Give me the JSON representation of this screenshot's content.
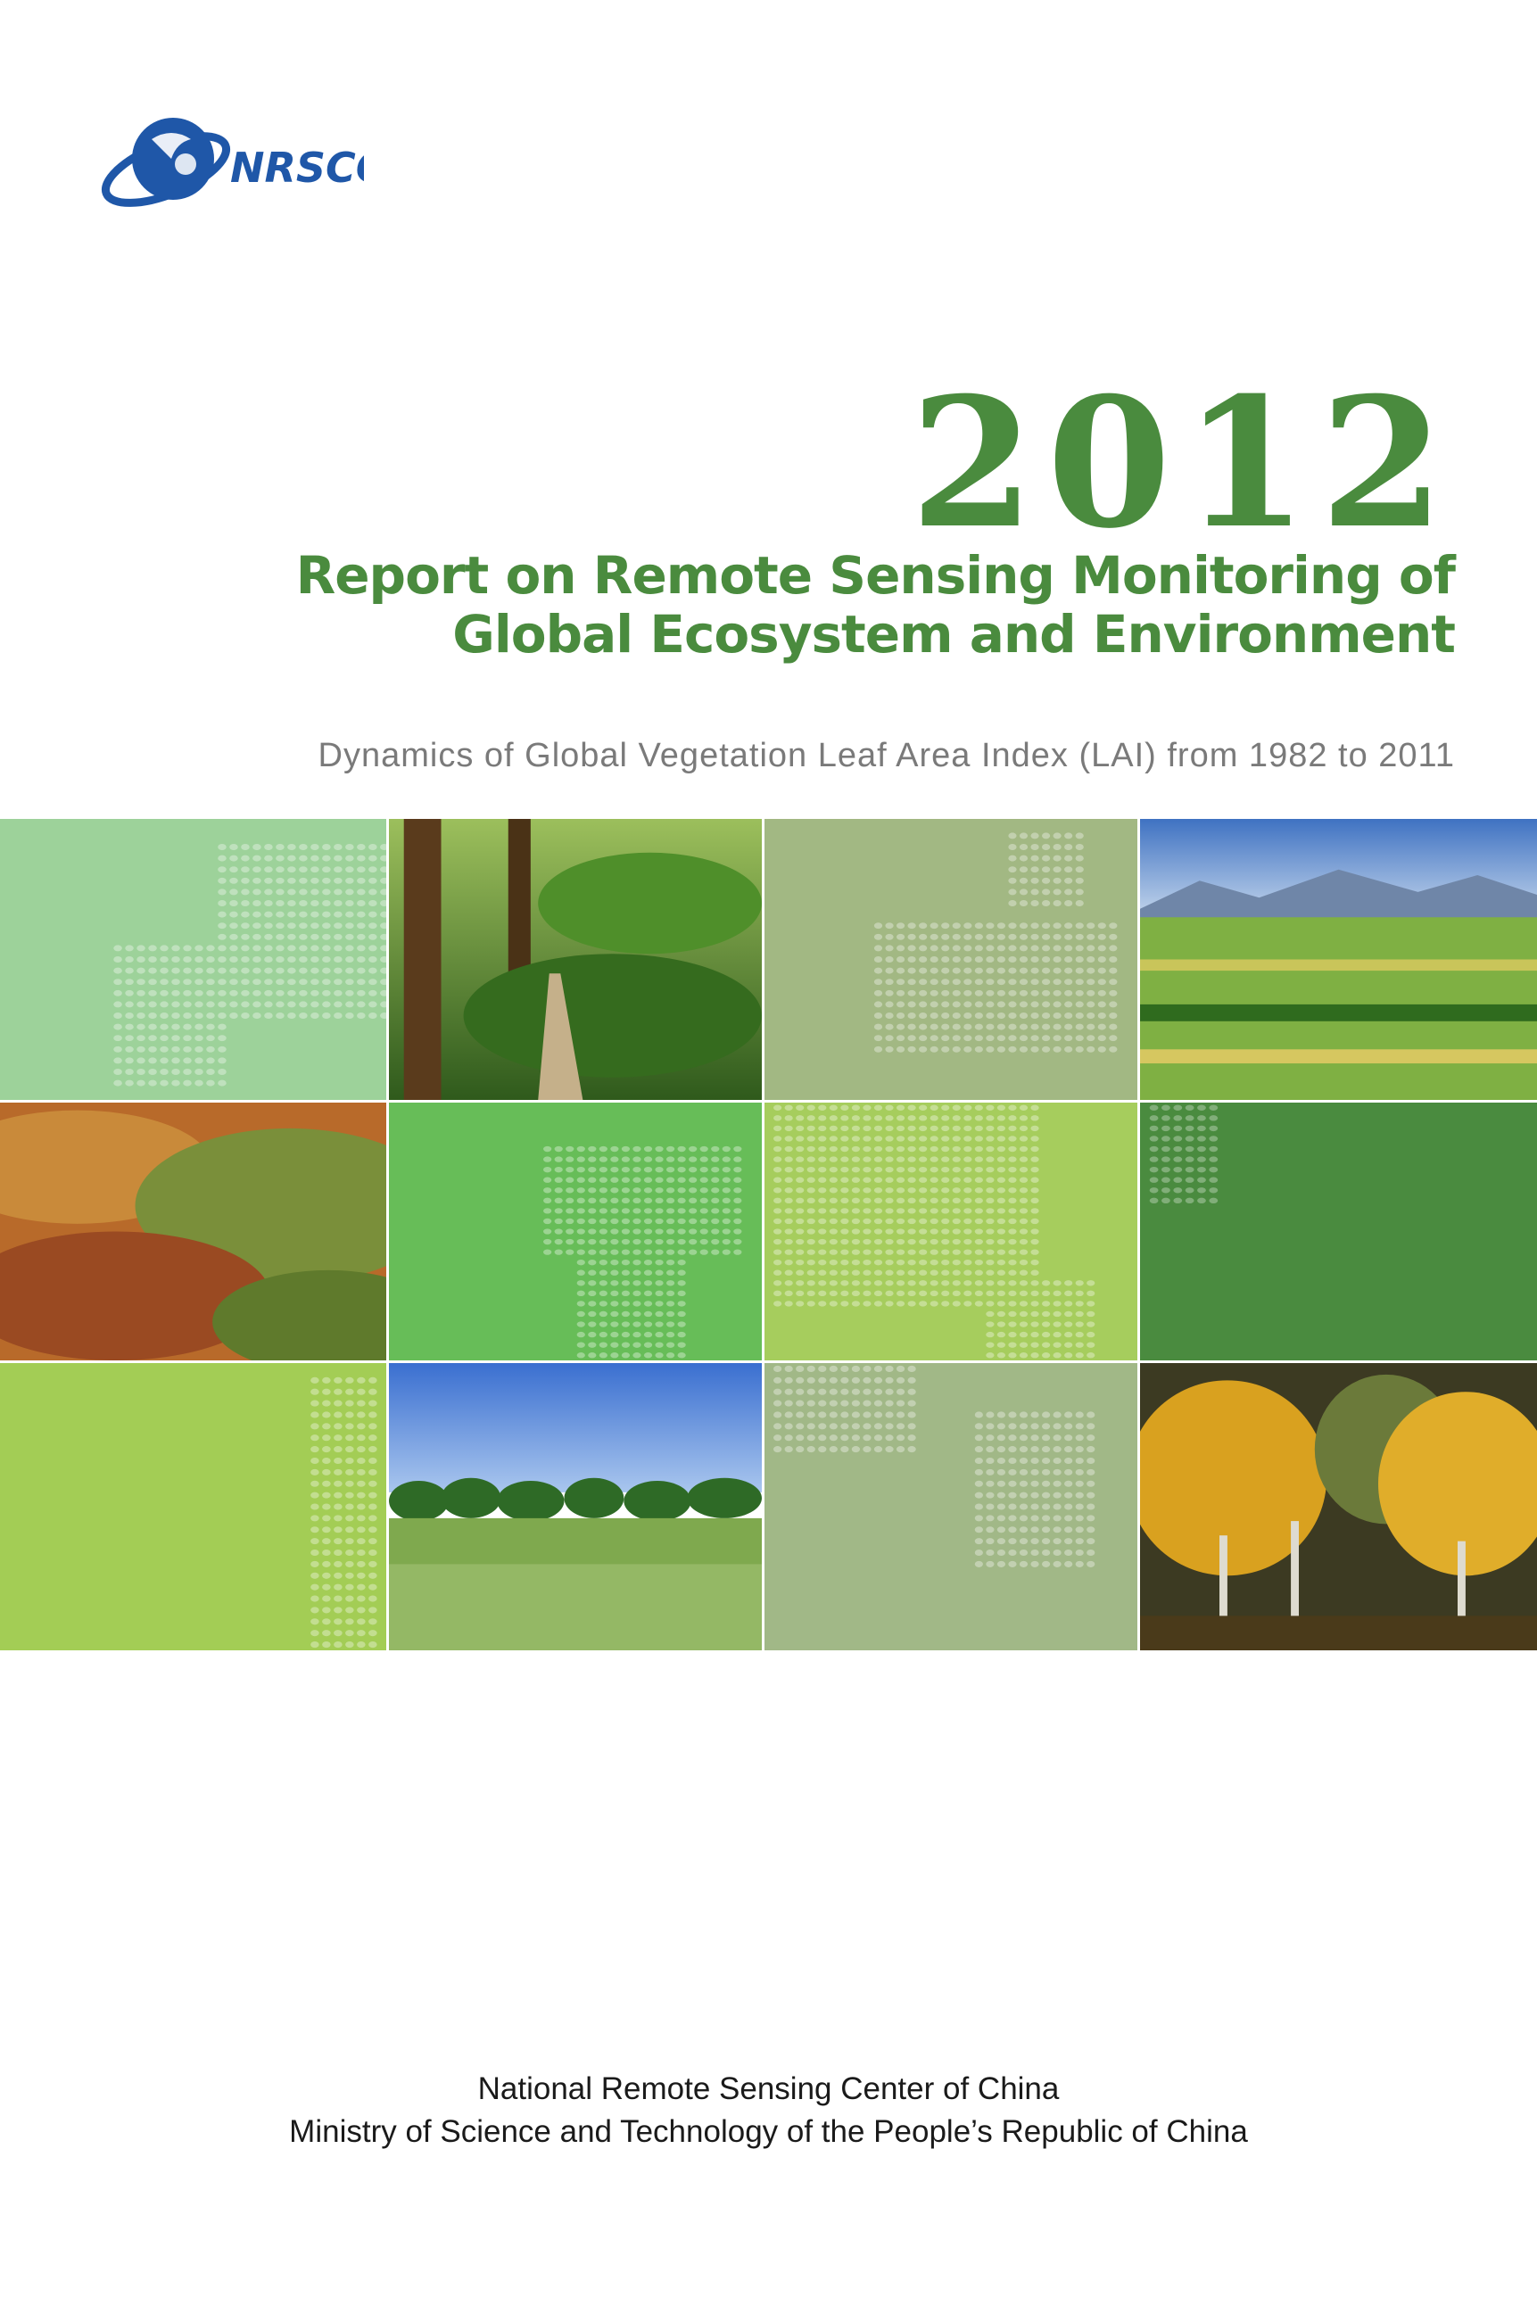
{
  "logo": {
    "text": "NRSCC",
    "icon": "globe-orbit-icon",
    "color": "#1f57a8"
  },
  "cover": {
    "year": "2012",
    "title_line1": "Report on Remote Sensing Monitoring of",
    "title_line2": "Global Ecosystem and Environment",
    "subtitle": "Dynamics of Global Vegetation Leaf Area Index (LAI) from 1982 to 2011",
    "accent_color": "#4a8b3e"
  },
  "mosaic": {
    "tiles": [
      {
        "kind": "map-tile",
        "color": "#9dd29a"
      },
      {
        "kind": "photo-forest-path"
      },
      {
        "kind": "map-tile",
        "color": "#a2b883"
      },
      {
        "kind": "photo-farmland-mountains"
      },
      {
        "kind": "photo-autumn-hills"
      },
      {
        "kind": "map-tile",
        "color": "#67bd58"
      },
      {
        "kind": "map-tile",
        "color": "#a6cd5d"
      },
      {
        "kind": "map-tile",
        "color": "#4a8b3f"
      },
      {
        "kind": "map-tile",
        "color": "#a3cd55"
      },
      {
        "kind": "photo-grassland-trees"
      },
      {
        "kind": "map-tile",
        "color": "#a1b887"
      },
      {
        "kind": "photo-golden-trees"
      }
    ]
  },
  "footer": {
    "line1": "National Remote Sensing Center of China",
    "line2": "Ministry of Science and Technology of the People’s Republic of China"
  }
}
